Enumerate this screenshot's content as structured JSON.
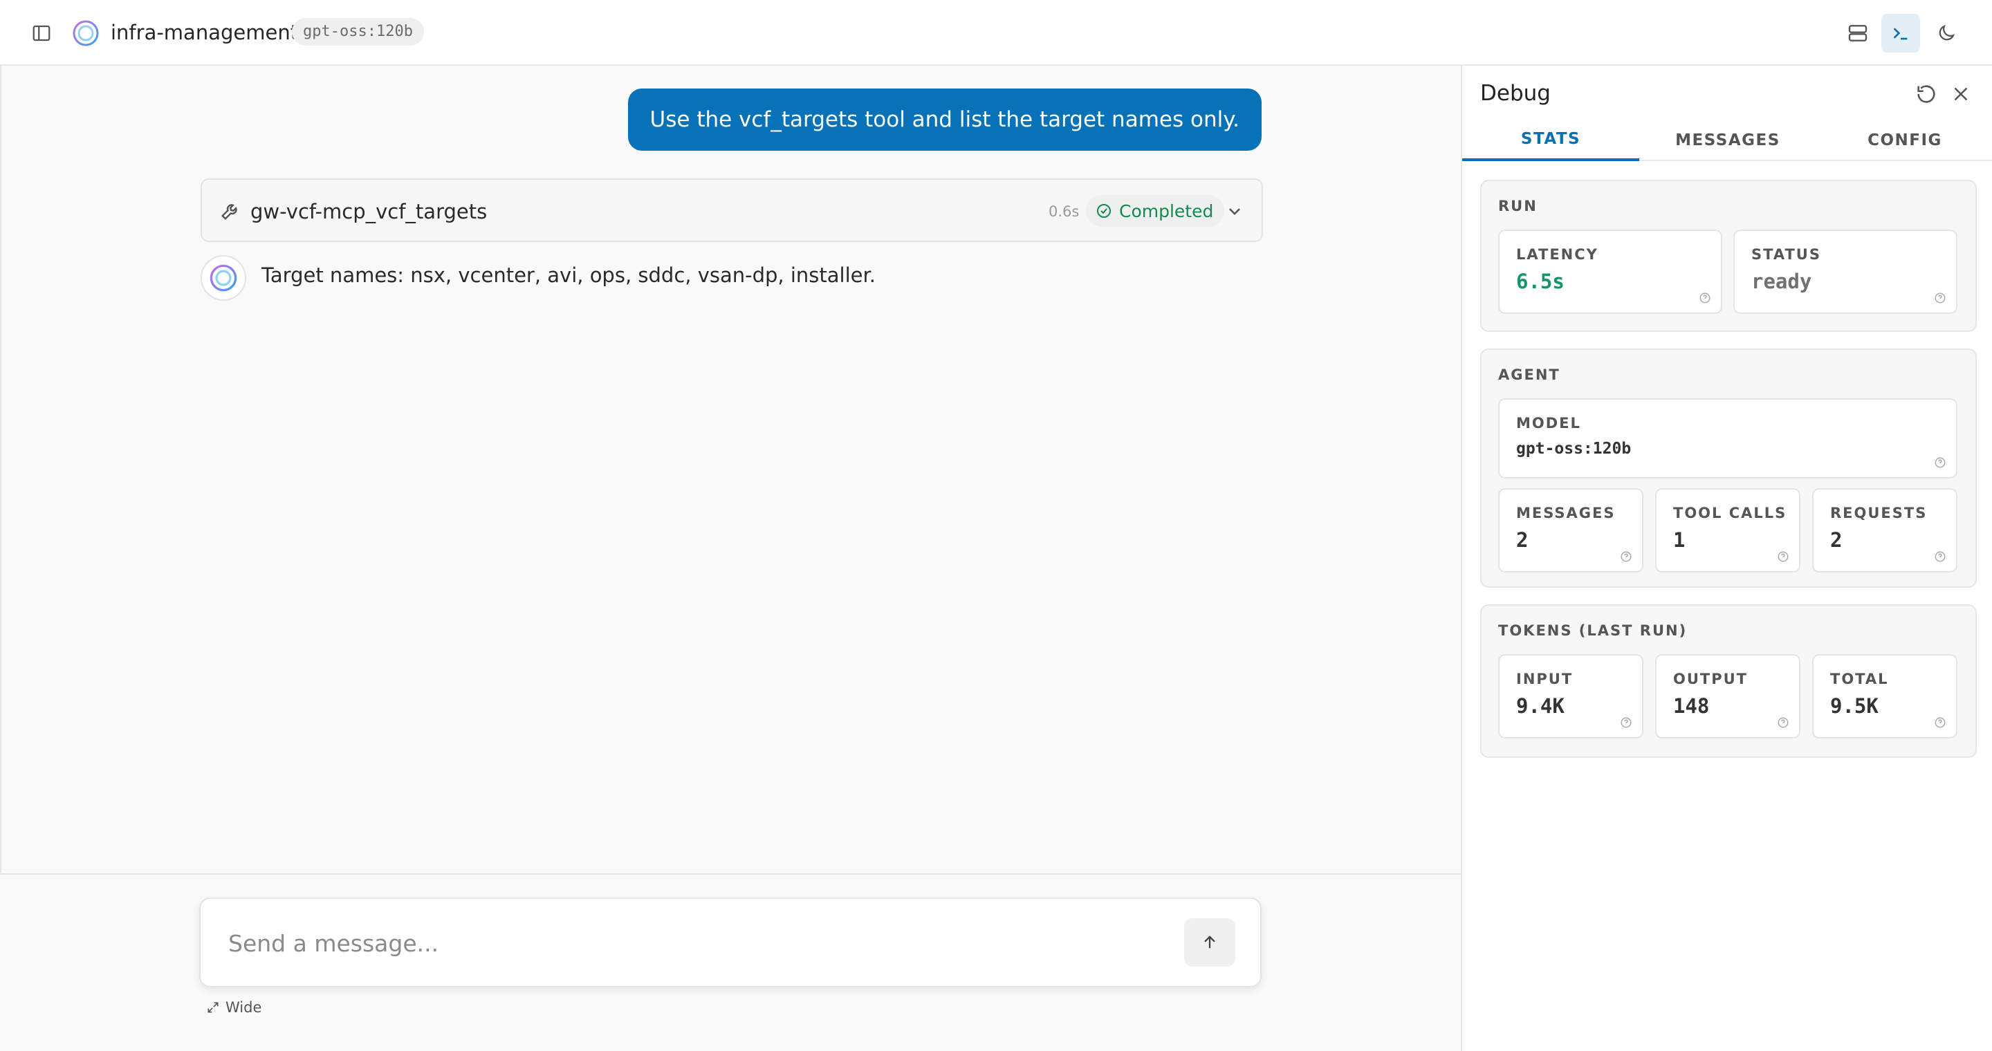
{
  "header": {
    "app_title": "infra-management",
    "model_badge": "gpt-oss:120b",
    "icons": [
      "sidebar-toggle-icon",
      "logo-icon",
      "layout-icon",
      "terminal-icon",
      "moon-icon"
    ]
  },
  "chat": {
    "user_message": "Use the vcf_targets tool and list the target names only.",
    "tool_call": {
      "name": "gw-vcf-mcp_vcf_targets",
      "duration": "0.6s",
      "status": "Completed"
    },
    "assistant_message": "Target names: nsx, vcenter, avi, ops, sddc, vsan-dp, installer."
  },
  "composer": {
    "placeholder": "Send a message...",
    "wide_label": "Wide"
  },
  "debug": {
    "title": "Debug",
    "tabs": [
      "STATS",
      "MESSAGES",
      "CONFIG"
    ],
    "active_tab": "STATS",
    "run": {
      "title": "RUN",
      "latency_label": "LATENCY",
      "latency_value": "6.5s",
      "status_label": "STATUS",
      "status_value": "ready"
    },
    "agent": {
      "title": "AGENT",
      "model_label": "MODEL",
      "model_value": "gpt-oss:120b",
      "messages_label": "MESSAGES",
      "messages_value": "2",
      "tool_calls_label": "TOOL CALLS",
      "tool_calls_value": "1",
      "requests_label": "REQUESTS",
      "requests_value": "2"
    },
    "tokens": {
      "title": "TOKENS (LAST RUN)",
      "input_label": "INPUT",
      "input_value": "9.4K",
      "output_label": "OUTPUT",
      "output_value": "148",
      "total_label": "TOTAL",
      "total_value": "9.5K"
    }
  },
  "colors": {
    "accent": "#0a6fb4",
    "user_bubble": "#0872b8",
    "success": "#138a4f",
    "latency": "#14956a"
  }
}
